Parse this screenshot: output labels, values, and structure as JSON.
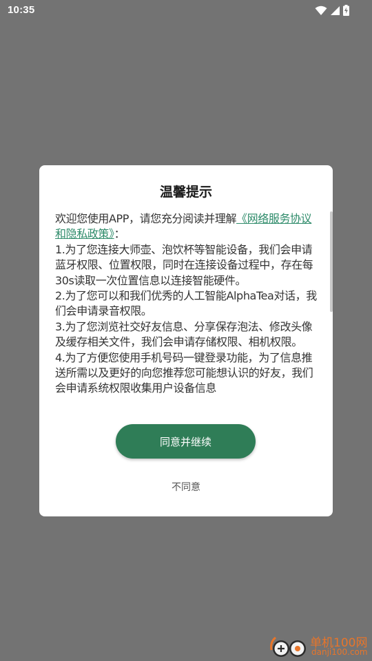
{
  "status_bar": {
    "time": "10:35",
    "icons": [
      "wifi-icon",
      "cell-signal-icon",
      "battery-charging-icon"
    ]
  },
  "dialog": {
    "title": "温馨提示",
    "intro": "欢迎您使用APP，请您充分阅读并理解",
    "policy_link": "《网络服务协议和隐私政策》",
    "intro_end": "：",
    "items": [
      "1.为了您连接大师壶、泡饮杯等智能设备，我们会申请蓝牙权限、位置权限，同时在连接设备过程中，存在每30s读取一次位置信息以连接智能硬件。",
      "2.为了您可以和我们优秀的人工智能AlphaTea对话，我们会申请录音权限。",
      "3.为了您浏览社交好友信息、分享保存泡法、修改头像及缓存相关文件，我们会申请存储权限、相机权限。",
      "4.为了方便您使用手机号码一键登录功能，为了信息推送所需以及更好的向您推荐您可能想认识的好友，我们会申请系统权限收集用户设备信息"
    ],
    "agree_label": "同意并继续",
    "disagree_label": "不同意"
  },
  "watermark": {
    "name": "单机100网",
    "domain": "danji100.com"
  },
  "colors": {
    "overlay": "#737373",
    "accent": "#2f7d57",
    "link": "#2e8b6a",
    "watermark": "#e8752a"
  }
}
